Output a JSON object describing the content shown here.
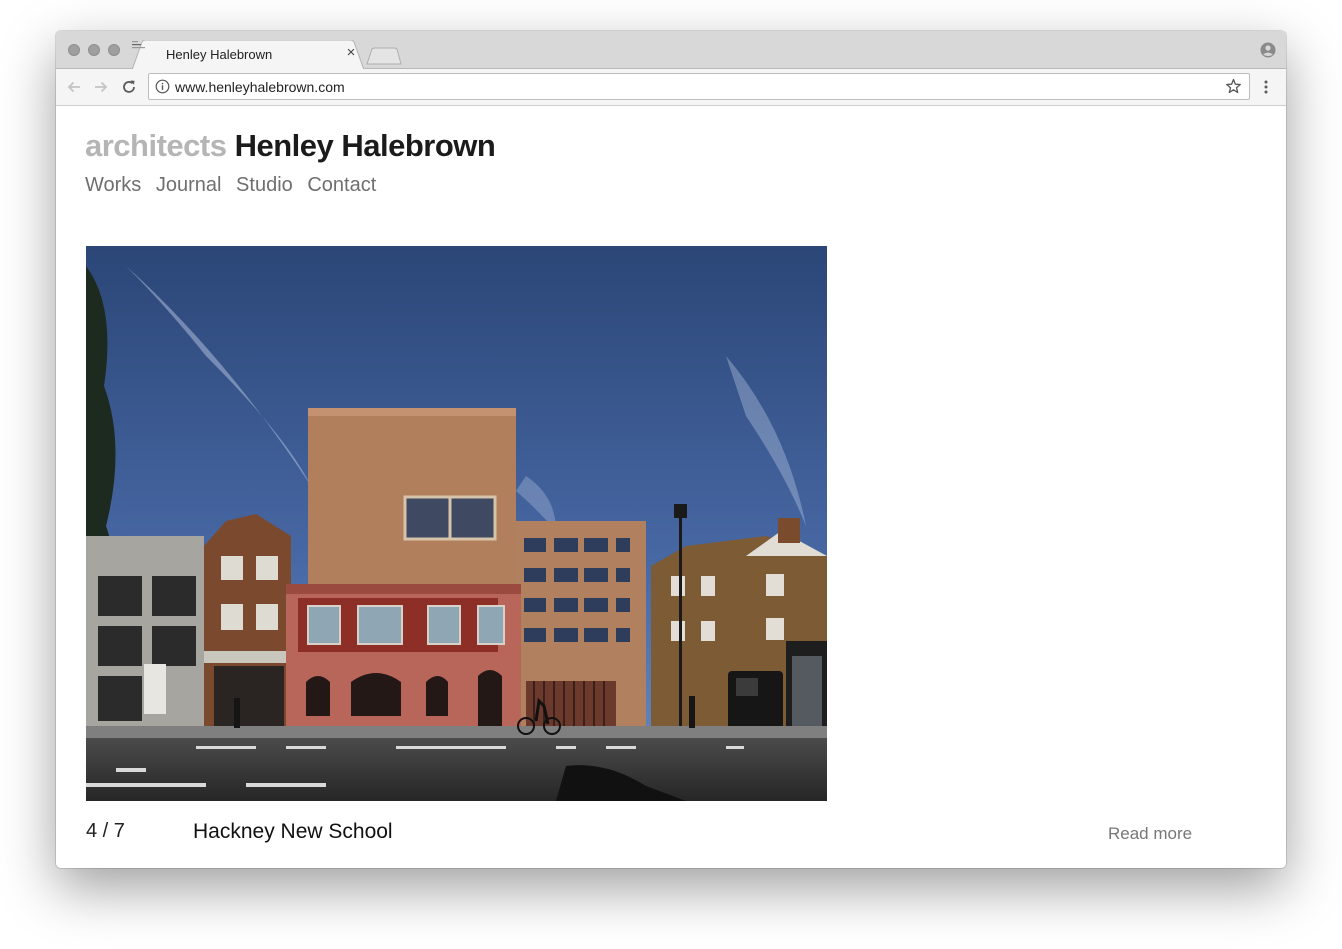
{
  "browser": {
    "tab_title": "Henley Halebrown",
    "tab_close": "×",
    "url": "www.henleyhalebrown.com"
  },
  "site": {
    "title_prefix": "architects",
    "title_name": "Henley Halebrown",
    "nav": [
      "Works",
      "Journal",
      "Studio",
      "Contact"
    ]
  },
  "slideshow": {
    "counter": "4 / 7",
    "project_title": "Hackney New School",
    "read_more": "Read more"
  },
  "colors": {
    "title_prefix": "#b5b5b5",
    "title_name": "#1b1b1b",
    "nav_text": "#6f6f6f",
    "read_more": "#777777"
  },
  "icons": {
    "back": "back-arrow-icon",
    "forward": "forward-arrow-icon",
    "reload": "reload-icon",
    "info": "info-icon",
    "bookmark": "star-icon",
    "menu": "kebab-menu-icon",
    "profile": "profile-icon"
  }
}
